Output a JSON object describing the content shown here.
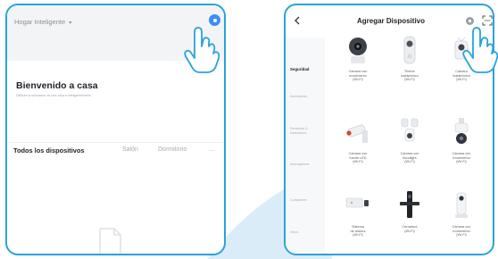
{
  "accent_color": "#29a3dc",
  "left_screen": {
    "home_title": "Hogar Inteligente",
    "home_caret": "▾",
    "add_icon": "plus-circle-icon",
    "welcome_title": "Bienvenido a casa",
    "welcome_subtitle": "Disfrute la sensación de una casa a inteligentemente",
    "tabs": [
      {
        "label": "Todos los dispositivos",
        "active": true
      },
      {
        "label": "Salón",
        "active": false
      },
      {
        "label": "Dormitorio",
        "active": false
      },
      {
        "label": "...",
        "active": false
      }
    ]
  },
  "right_screen": {
    "title": "Agregar Dispositivo",
    "back_icon": "chevron-left-icon",
    "scan_icon": "scan-icon",
    "qr_icon": "qr-scan-icon",
    "categories": [
      {
        "label": "Seguridad",
        "active": true
      },
      {
        "label": "Iluminación",
        "active": false
      },
      {
        "label": "Sensores & Detectores",
        "active": false
      },
      {
        "label": "Interruptores",
        "active": false
      },
      {
        "label": "Cortadores",
        "active": false
      },
      {
        "label": "Otros",
        "active": false
      }
    ],
    "devices": [
      {
        "label": "Cámara con\nmovimiento\n(Wi-Fi)",
        "icon": "camera-pan-icon"
      },
      {
        "label": "Timbre\ninalámbrico\n(Wi-Fi)",
        "icon": "doorbell-camera-icon"
      },
      {
        "label": "Cámara\ninalámbrica\n(Wi-Fi)",
        "icon": "wireless-camera-icon"
      },
      {
        "label": "Cámara con\nfuente LED\n(Wi-Fi)",
        "icon": "led-camera-icon"
      },
      {
        "label": "Cámara con\nfloodlight\n(Wi-Fi)",
        "icon": "floodlight-camera-icon"
      },
      {
        "label": "Cámara con\nmovimiento\n(Wi-Fi)",
        "icon": "outdoor-ptz-camera-icon"
      },
      {
        "label": "Sistema\nde alarma\n(Wi-Fi)",
        "icon": "alarm-system-icon"
      },
      {
        "label": "Cerradura\n(Wi-Fi)",
        "icon": "smart-lock-icon"
      },
      {
        "label": "Cámara con\nmovimiento\n(Wi-Fi)",
        "icon": "indoor-camera-icon"
      }
    ]
  }
}
